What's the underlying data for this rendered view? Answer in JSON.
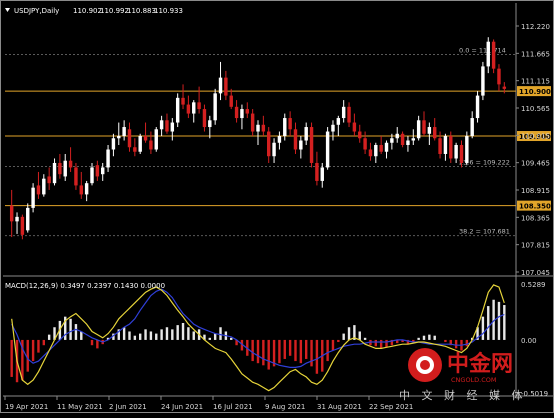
{
  "chart_data": {
    "type": "candlestick",
    "symbol_line": {
      "symbol": "USDJPY,Daily",
      "ohlc": [
        "110.902",
        "110.992",
        "110.883",
        "110.933"
      ]
    },
    "price_axis": {
      "ylim": [
        106.85,
        112.55
      ],
      "ticks": [
        "112.220",
        "111.665",
        "111.115",
        "110.565",
        "110.015",
        "109.465",
        "108.915",
        "108.365",
        "107.815",
        "107.045"
      ]
    },
    "date_labels": [
      "19 Apr 2021",
      "11 May 2021",
      "2 Jun 2021",
      "24 Jun 2021",
      "16 Jul 2021",
      "9 Aug 2021",
      "31 Aug 2021",
      "22 Sep 2021"
    ],
    "horizontal_levels": [
      {
        "label": "110.900",
        "value": 110.9,
        "color": "#e2a52a"
      },
      {
        "label": "109.900",
        "value": 109.9,
        "color": "#e2a52a"
      },
      {
        "label": "108.350",
        "value": 108.35,
        "color": "#e2a52a"
      }
    ],
    "fib_levels": [
      {
        "label": "0.0 = 111.714",
        "value": 111.714
      },
      {
        "label": "23.6 = 109.222",
        "value": 109.222
      },
      {
        "label": "38.2 = 107.681",
        "value": 107.681
      }
    ],
    "candles": [
      [
        108.35,
        108.7,
        107.65,
        108.0
      ],
      [
        108.0,
        108.2,
        107.72,
        108.1
      ],
      [
        108.1,
        108.15,
        107.6,
        107.7
      ],
      [
        107.8,
        108.4,
        107.75,
        108.3
      ],
      [
        108.3,
        108.85,
        108.2,
        108.75
      ],
      [
        108.8,
        109.1,
        108.5,
        108.6
      ],
      [
        108.6,
        109.05,
        108.55,
        108.95
      ],
      [
        109.0,
        109.2,
        108.7,
        108.85
      ],
      [
        108.85,
        109.4,
        108.8,
        109.3
      ],
      [
        109.3,
        109.5,
        108.95,
        109.05
      ],
      [
        109.0,
        109.5,
        108.9,
        109.35
      ],
      [
        109.35,
        109.65,
        109.1,
        109.2
      ],
      [
        109.2,
        109.3,
        108.7,
        108.8
      ],
      [
        108.8,
        109.1,
        108.5,
        108.6
      ],
      [
        108.6,
        108.9,
        108.45,
        108.85
      ],
      [
        108.85,
        109.3,
        108.8,
        109.2
      ],
      [
        109.25,
        109.35,
        108.9,
        109.0
      ],
      [
        109.05,
        109.3,
        108.9,
        109.2
      ],
      [
        109.2,
        109.7,
        109.1,
        109.6
      ],
      [
        109.6,
        109.95,
        109.45,
        109.85
      ],
      [
        109.85,
        110.2,
        109.7,
        109.9
      ],
      [
        109.9,
        110.25,
        109.8,
        110.1
      ],
      [
        110.05,
        110.2,
        109.55,
        109.65
      ],
      [
        109.65,
        109.85,
        109.45,
        109.55
      ],
      [
        109.55,
        109.95,
        109.5,
        109.9
      ],
      [
        109.9,
        110.2,
        109.75,
        109.8
      ],
      [
        109.8,
        110.0,
        109.5,
        109.6
      ],
      [
        109.6,
        110.1,
        109.55,
        110.05
      ],
      [
        110.05,
        110.35,
        109.9,
        110.25
      ],
      [
        110.25,
        110.4,
        109.95,
        110.0
      ],
      [
        110.0,
        110.3,
        109.8,
        110.2
      ],
      [
        110.2,
        110.85,
        110.1,
        110.75
      ],
      [
        110.75,
        111.05,
        110.5,
        110.6
      ],
      [
        110.6,
        110.8,
        110.3,
        110.4
      ],
      [
        110.4,
        110.7,
        110.2,
        110.65
      ],
      [
        110.65,
        111.0,
        110.4,
        110.5
      ],
      [
        110.5,
        110.6,
        110.0,
        110.1
      ],
      [
        110.1,
        110.35,
        109.85,
        110.25
      ],
      [
        110.25,
        110.95,
        110.15,
        110.85
      ],
      [
        110.85,
        111.55,
        110.7,
        111.2
      ],
      [
        111.2,
        111.35,
        110.7,
        110.8
      ],
      [
        110.8,
        110.95,
        110.5,
        110.55
      ],
      [
        110.55,
        110.7,
        110.2,
        110.3
      ],
      [
        110.3,
        110.6,
        110.05,
        110.5
      ],
      [
        110.5,
        110.65,
        110.3,
        110.4
      ],
      [
        110.4,
        110.5,
        109.9,
        110.0
      ],
      [
        110.0,
        110.25,
        109.7,
        110.15
      ],
      [
        110.15,
        110.35,
        109.9,
        110.0
      ],
      [
        110.0,
        110.1,
        109.3,
        109.45
      ],
      [
        109.45,
        109.85,
        109.3,
        109.75
      ],
      [
        109.75,
        110.0,
        109.6,
        109.9
      ],
      [
        109.9,
        110.4,
        109.8,
        110.3
      ],
      [
        110.3,
        110.45,
        109.9,
        110.05
      ],
      [
        110.05,
        110.2,
        109.5,
        109.6
      ],
      [
        109.6,
        109.9,
        109.4,
        109.8
      ],
      [
        109.8,
        110.2,
        109.7,
        110.1
      ],
      [
        110.1,
        110.2,
        109.2,
        109.3
      ],
      [
        109.3,
        109.55,
        108.8,
        108.9
      ],
      [
        108.9,
        109.3,
        108.75,
        109.2
      ],
      [
        109.2,
        110.1,
        109.15,
        110.0
      ],
      [
        110.0,
        110.25,
        109.8,
        110.15
      ],
      [
        110.15,
        110.35,
        109.9,
        110.3
      ],
      [
        110.3,
        110.7,
        110.2,
        110.55
      ],
      [
        110.55,
        110.65,
        110.1,
        110.2
      ],
      [
        110.2,
        110.4,
        109.9,
        110.0
      ],
      [
        110.0,
        110.15,
        109.75,
        109.85
      ],
      [
        109.85,
        110.0,
        109.5,
        109.6
      ],
      [
        109.6,
        109.75,
        109.35,
        109.45
      ],
      [
        109.45,
        109.75,
        109.3,
        109.7
      ],
      [
        109.7,
        109.9,
        109.5,
        109.55
      ],
      [
        109.55,
        109.8,
        109.4,
        109.75
      ],
      [
        109.75,
        109.95,
        109.6,
        109.85
      ],
      [
        109.85,
        110.1,
        109.75,
        109.95
      ],
      [
        109.95,
        110.0,
        109.65,
        109.7
      ],
      [
        109.7,
        109.9,
        109.55,
        109.8
      ],
      [
        109.8,
        110.05,
        109.7,
        109.85
      ],
      [
        109.85,
        110.35,
        109.8,
        110.25
      ],
      [
        110.25,
        110.45,
        109.9,
        109.95
      ],
      [
        109.95,
        110.2,
        109.7,
        110.1
      ],
      [
        110.1,
        110.3,
        109.8,
        109.85
      ],
      [
        109.85,
        110.0,
        109.4,
        109.5
      ],
      [
        109.5,
        109.95,
        109.35,
        109.9
      ],
      [
        109.9,
        110.0,
        109.3,
        109.4
      ],
      [
        109.4,
        109.75,
        109.3,
        109.7
      ],
      [
        109.7,
        109.8,
        109.2,
        109.3
      ],
      [
        109.3,
        110.0,
        109.25,
        109.9
      ],
      [
        109.9,
        110.45,
        109.85,
        110.3
      ],
      [
        110.3,
        110.9,
        110.2,
        110.8
      ],
      [
        110.8,
        111.55,
        110.7,
        111.45
      ],
      [
        111.45,
        112.1,
        111.3,
        112.0
      ],
      [
        112.0,
        112.05,
        111.3,
        111.4
      ],
      [
        111.4,
        111.5,
        110.9,
        111.05
      ],
      [
        111.0,
        111.1,
        110.85,
        110.95
      ]
    ],
    "macd": {
      "label": "MACD(12,26,9) 0.3497 0.2397 0.1430 0.0000",
      "params": "12,26,9",
      "values": [
        0.3497,
        0.2397,
        0.143,
        0.0
      ],
      "ticks": [
        "0.5289",
        "0.00",
        "-0.5019"
      ],
      "ylim": [
        -0.5019,
        0.5289
      ],
      "histogram": [
        -0.35,
        -0.4,
        -0.38,
        -0.3,
        -0.2,
        -0.12,
        -0.05,
        0.05,
        0.12,
        0.18,
        0.22,
        0.2,
        0.15,
        0.08,
        0.0,
        -0.05,
        -0.08,
        -0.04,
        0.02,
        0.06,
        0.1,
        0.12,
        0.08,
        0.04,
        0.06,
        0.1,
        0.08,
        0.06,
        0.1,
        0.12,
        0.1,
        0.14,
        0.16,
        0.12,
        0.08,
        0.1,
        0.05,
        0.02,
        0.06,
        0.12,
        0.08,
        0.02,
        -0.05,
        -0.1,
        -0.15,
        -0.2,
        -0.22,
        -0.24,
        -0.28,
        -0.25,
        -0.22,
        -0.18,
        -0.15,
        -0.2,
        -0.22,
        -0.18,
        -0.25,
        -0.32,
        -0.3,
        -0.2,
        -0.1,
        -0.02,
        0.06,
        0.12,
        0.14,
        0.08,
        0.02,
        -0.05,
        -0.06,
        -0.08,
        -0.07,
        -0.05,
        -0.03,
        -0.02,
        -0.04,
        -0.02,
        0.02,
        0.04,
        0.05,
        0.04,
        0.0,
        -0.02,
        -0.05,
        -0.08,
        -0.1,
        -0.06,
        0.02,
        0.12,
        0.22,
        0.32,
        0.38,
        0.36,
        0.33
      ],
      "signal": [
        0.15,
        0.05,
        -0.08,
        -0.18,
        -0.22,
        -0.2,
        -0.15,
        -0.1,
        -0.05,
        0.0,
        0.05,
        0.08,
        0.1,
        0.08,
        0.05,
        0.02,
        0.0,
        -0.02,
        0.0,
        0.04,
        0.08,
        0.12,
        0.15,
        0.2,
        0.28,
        0.35,
        0.42,
        0.46,
        0.48,
        0.45,
        0.4,
        0.32,
        0.25,
        0.2,
        0.15,
        0.12,
        0.1,
        0.08,
        0.06,
        0.05,
        0.04,
        0.03,
        0.0,
        -0.04,
        -0.08,
        -0.12,
        -0.15,
        -0.18,
        -0.2,
        -0.22,
        -0.24,
        -0.25,
        -0.26,
        -0.26,
        -0.25,
        -0.22,
        -0.2,
        -0.18,
        -0.15,
        -0.12,
        -0.1,
        -0.08,
        -0.06,
        -0.05,
        -0.04,
        -0.04,
        -0.03,
        -0.02,
        -0.02,
        -0.02,
        -0.02,
        -0.01,
        0.0,
        0.0,
        -0.01,
        -0.02,
        -0.02,
        -0.03,
        -0.04,
        -0.04,
        -0.04,
        -0.04,
        -0.04,
        -0.05,
        -0.05,
        -0.04,
        -0.02,
        0.02,
        0.06,
        0.12,
        0.18,
        0.22,
        0.24
      ],
      "macd_line": [
        0.2,
        -0.2,
        -0.38,
        -0.42,
        -0.38,
        -0.3,
        -0.2,
        -0.1,
        0.0,
        0.1,
        0.18,
        0.22,
        0.25,
        0.2,
        0.15,
        0.08,
        0.05,
        0.02,
        0.06,
        0.12,
        0.2,
        0.25,
        0.3,
        0.35,
        0.4,
        0.45,
        0.48,
        0.5,
        0.47,
        0.42,
        0.35,
        0.28,
        0.22,
        0.15,
        0.1,
        0.05,
        0.0,
        -0.04,
        -0.08,
        -0.1,
        -0.12,
        -0.18,
        -0.25,
        -0.32,
        -0.36,
        -0.4,
        -0.42,
        -0.45,
        -0.48,
        -0.45,
        -0.4,
        -0.35,
        -0.3,
        -0.28,
        -0.32,
        -0.35,
        -0.4,
        -0.42,
        -0.38,
        -0.3,
        -0.2,
        -0.12,
        -0.05,
        0.0,
        0.02,
        0.0,
        -0.04,
        -0.06,
        -0.08,
        -0.08,
        -0.07,
        -0.06,
        -0.05,
        -0.04,
        -0.04,
        -0.03,
        -0.02,
        -0.02,
        -0.03,
        -0.04,
        -0.05,
        -0.06,
        -0.08,
        -0.1,
        -0.12,
        -0.08,
        0.0,
        0.12,
        0.28,
        0.45,
        0.52,
        0.5,
        0.35
      ]
    }
  },
  "watermark": {
    "name": "中金网",
    "domain": "CNGOLD.COM",
    "tagline": "中 文 财 经 媒 体"
  },
  "colors": {
    "bull": "#ffffff",
    "bear": "#d42020",
    "level": "#e2a52a",
    "grid": "#5a5a5a",
    "macd_line": "#e6d43a",
    "signal_line": "#2f3fd8",
    "hist_pos": "#e8e8e8",
    "hist_neg": "#d42020"
  }
}
